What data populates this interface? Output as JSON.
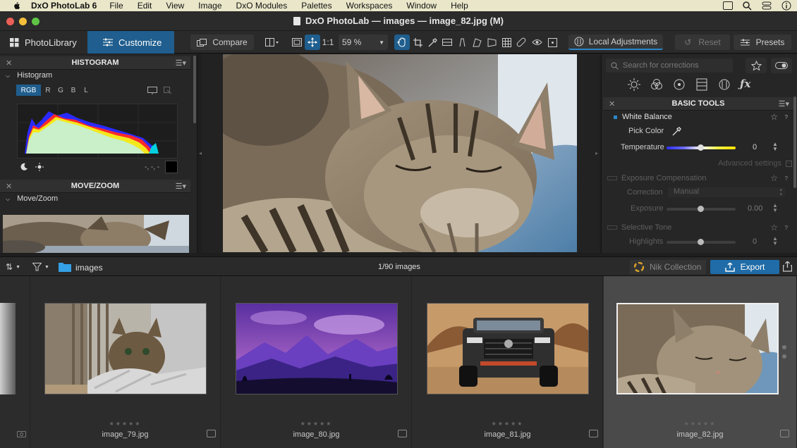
{
  "menubar": {
    "app_name": "DxO PhotoLab 6",
    "items": [
      "File",
      "Edit",
      "View",
      "Image",
      "DxO Modules",
      "Palettes",
      "Workspaces",
      "Window",
      "Help"
    ]
  },
  "window": {
    "title": "DxO PhotoLab — images — image_82.jpg (M)"
  },
  "toolbar": {
    "tab_photolibrary": "PhotoLibrary",
    "tab_customize": "Customize",
    "compare": "Compare",
    "one_to_one": "1:1",
    "zoom": "59 %",
    "local_adjustments": "Local Adjustments",
    "reset": "Reset",
    "presets": "Presets"
  },
  "histogram": {
    "header": "HISTOGRAM",
    "subhead": "Histogram",
    "channels": [
      "RGB",
      "R",
      "G",
      "B",
      "L"
    ],
    "readout": "-, -, -"
  },
  "movezoom": {
    "header": "MOVE/ZOOM",
    "subhead": "Move/Zoom"
  },
  "right": {
    "search_placeholder": "Search for corrections",
    "basic_tools": "BASIC TOOLS",
    "white_balance": "White Balance",
    "pick_color": "Pick Color",
    "temperature_label": "Temperature",
    "temperature_value": "0",
    "advanced": "Advanced settings",
    "exposure_comp": "Exposure Compensation",
    "correction_label": "Correction",
    "correction_value": "Manual",
    "exposure_label": "Exposure",
    "exposure_value": "0.00",
    "selective_tone": "Selective Tone",
    "highlights_label": "Highlights",
    "highlights_value": "0"
  },
  "filmbar": {
    "folder": "images",
    "count": "1/90 images",
    "nik": "Nik Collection",
    "export": "Export"
  },
  "filmstrip": [
    {
      "name": "image_79.jpg",
      "stars": "★★★★★"
    },
    {
      "name": "image_80.jpg",
      "stars": "★★★★★"
    },
    {
      "name": "image_81.jpg",
      "stars": "★★★★★"
    },
    {
      "name": "image_82.jpg",
      "stars": "★★★★★"
    }
  ],
  "colors": {
    "accent": "#1f5e8e",
    "export": "#1f6ca8",
    "menubar": "#e9e6c9"
  }
}
